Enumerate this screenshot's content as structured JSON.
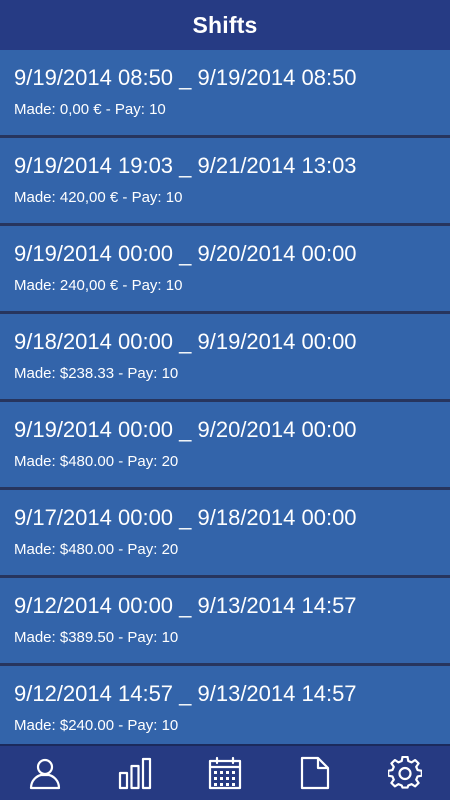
{
  "header": {
    "title": "Shifts"
  },
  "shifts": [
    {
      "range": "9/19/2014 08:50 _ 9/19/2014 08:50",
      "summary": "Made: 0,00 € - Pay: 10"
    },
    {
      "range": "9/19/2014 19:03 _ 9/21/2014 13:03",
      "summary": "Made: 420,00 € - Pay: 10"
    },
    {
      "range": "9/19/2014 00:00 _ 9/20/2014 00:00",
      "summary": "Made: 240,00 € - Pay: 10"
    },
    {
      "range": "9/18/2014 00:00 _ 9/19/2014 00:00",
      "summary": "Made: $238.33 - Pay: 10"
    },
    {
      "range": "9/19/2014 00:00 _ 9/20/2014 00:00",
      "summary": "Made: $480.00 - Pay: 20"
    },
    {
      "range": "9/17/2014 00:00 _ 9/18/2014 00:00",
      "summary": "Made: $480.00 - Pay: 20"
    },
    {
      "range": "9/12/2014 00:00 _ 9/13/2014 14:57",
      "summary": "Made: $389.50 - Pay: 10"
    },
    {
      "range": "9/12/2014 14:57 _ 9/13/2014 14:57",
      "summary": "Made: $240.00 - Pay: 10"
    }
  ],
  "bottom_nav": {
    "items": [
      {
        "icon": "user-icon"
      },
      {
        "icon": "bar-chart-icon"
      },
      {
        "icon": "calendar-icon"
      },
      {
        "icon": "document-icon"
      },
      {
        "icon": "gear-icon"
      }
    ]
  },
  "colors": {
    "header_bg": "#263b84",
    "row_bg": "#3364aa",
    "separator": "#27355e",
    "bottom_bar_bg": "#263a82",
    "text": "#ffffff"
  }
}
